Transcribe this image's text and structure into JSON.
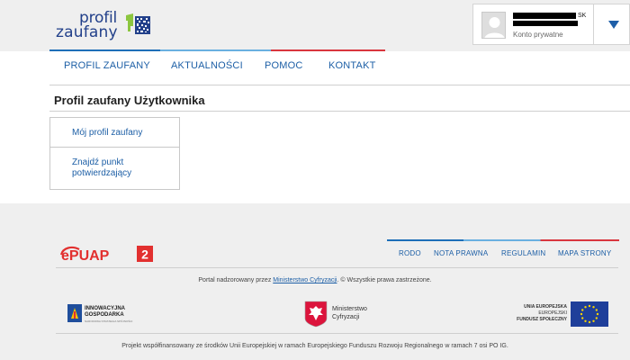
{
  "header": {
    "logo_line1": "profil",
    "logo_line2": "zaufany",
    "user": {
      "name_suffix": "SKI",
      "account_type": "Konto prywatne"
    }
  },
  "nav": {
    "items": [
      "PROFIL ZAUFANY",
      "AKTUALNOŚCI",
      "POMOC",
      "KONTAKT"
    ]
  },
  "main": {
    "title": "Profil zaufany Użytkownika",
    "menu": [
      "Mój profil zaufany",
      "Znajdź punkt potwierdzający"
    ]
  },
  "footer": {
    "brand": "ePUAP",
    "brand_version": "2",
    "links": [
      "RODO",
      "NOTA PRAWNA",
      "REGULAMIN",
      "MAPA STRONY"
    ],
    "notice_prefix": "Portal nadzorowany przez ",
    "notice_link": "Ministerstwo Cyfryzacji",
    "notice_suffix": ". © Wszystkie prawa zastrzeżone.",
    "logos": {
      "ig_line1": "INNOWACYJNA",
      "ig_line2": "GOSPODARKA",
      "ig_small": "NARODOWA STRATEGIA SPÓJNOŚCI",
      "mc_line1": "Ministerstwo",
      "mc_line2": "Cyfryzacji",
      "eu_line1": "UNIA EUROPEJSKA",
      "eu_line2": "EUROPEJSKI",
      "eu_line3": "FUNDUSZ SPOŁECZNY"
    },
    "cofinancing": "Projekt współfinansowany ze środków Unii Europejskiej w ramach Europejskiego Funduszu Rozwoju Regionalnego w ramach 7 osi PO IG."
  },
  "colors": {
    "link_blue": "#1d5fa6",
    "brand_navy": "#22408a",
    "epuap_red": "#e2302f",
    "accent_green": "#8cc63f"
  }
}
